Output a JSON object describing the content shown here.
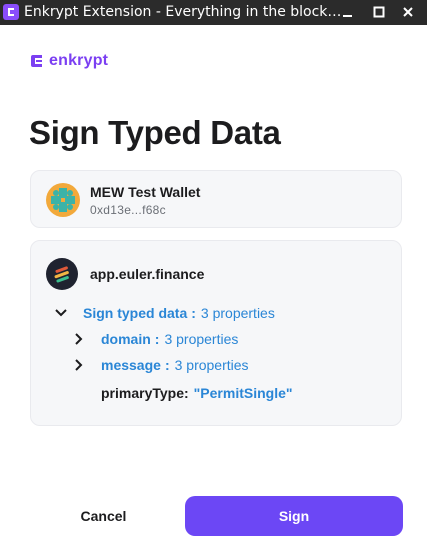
{
  "window": {
    "title": "Enkrypt Extension - Everything in the block…",
    "controls": [
      "minimize",
      "maximize",
      "close"
    ]
  },
  "brand": {
    "name": "enkrypt",
    "color": "#7b3ff2"
  },
  "page": {
    "title": "Sign Typed Data"
  },
  "wallet": {
    "name": "MEW Test Wallet",
    "address": "0xd13e...f68c"
  },
  "request": {
    "site": "app.euler.finance",
    "tree": {
      "root_key": "Sign typed data",
      "root_count": "3 properties",
      "children": [
        {
          "key": "domain",
          "count": "3 properties"
        },
        {
          "key": "message",
          "count": "3 properties"
        }
      ],
      "primary_type_key": "primaryType:",
      "primary_type_value": "\"PermitSingle\""
    }
  },
  "actions": {
    "cancel_label": "Cancel",
    "sign_label": "Sign"
  },
  "colors": {
    "accent": "#6c47f5",
    "link": "#2a86d6",
    "titlebar": "#2b2b2b"
  }
}
